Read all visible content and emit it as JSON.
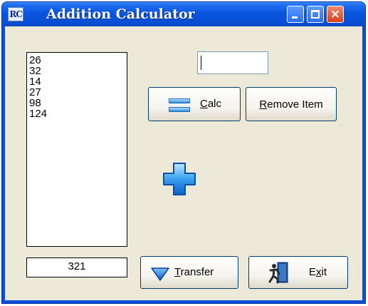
{
  "window": {
    "title": "Addition Calculator",
    "app_icon_text": "RC",
    "controls": {
      "minimize": "minimize",
      "maximize": "maximize",
      "close": "×"
    }
  },
  "list": {
    "items": [
      "26",
      "32",
      "14",
      "27",
      "98",
      "124"
    ]
  },
  "total": "321",
  "input": {
    "value": ""
  },
  "buttons": {
    "calc": {
      "mnemonic": "C",
      "rest": "alc"
    },
    "remove": {
      "mnemonic": "R",
      "rest": "emove Item"
    },
    "transfer": {
      "mnemonic": "T",
      "rest": "ransfer"
    },
    "exit": {
      "pre": "E",
      "mnemonic": "x",
      "rest": "it"
    }
  },
  "icons": {
    "calc": "equals-icon",
    "transfer": "down-triangle-icon",
    "exit": "exit-door-icon",
    "center": "plus-icon"
  },
  "colors": {
    "titlebar": "#0a55df",
    "client": "#ece9d8",
    "accent_blue": "#2f8ee0"
  }
}
